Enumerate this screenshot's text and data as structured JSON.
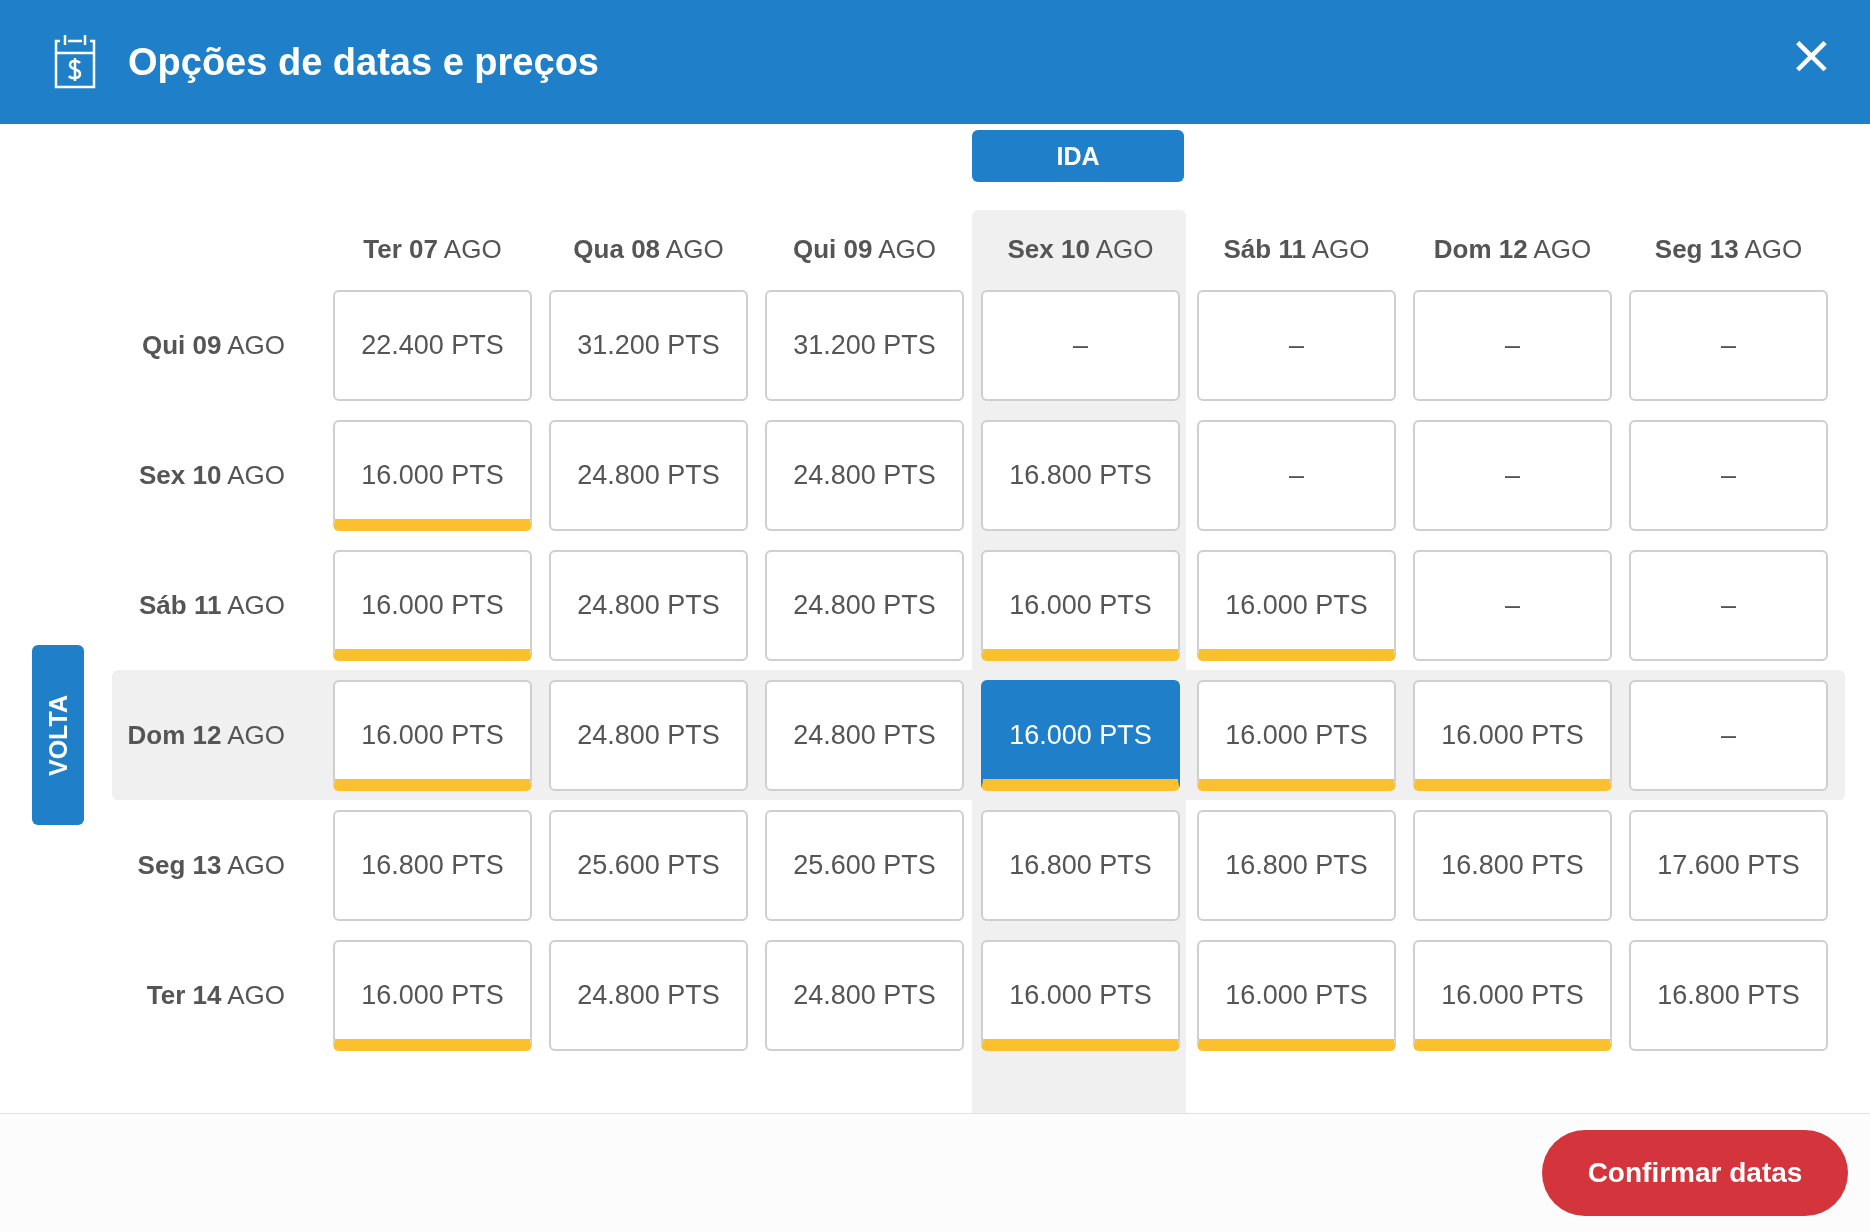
{
  "dialog": {
    "title": "Opções de datas e preços",
    "close": "×"
  },
  "outbound_tab": "IDA",
  "return_tab": "VOLTA",
  "columns": [
    {
      "label": "**Ter 07** AGO",
      "selected": false
    },
    {
      "label": "**Qua 08** AGO",
      "selected": false
    },
    {
      "label": "**Qui 09** AGO",
      "selected": false
    },
    {
      "label": "**Sex 10** AGO",
      "selected": true
    },
    {
      "label": "**Sáb 11** AGO",
      "selected": false
    },
    {
      "label": "**Dom 12** AGO",
      "selected": false
    },
    {
      "label": "**Seg 13** AGO",
      "selected": false
    }
  ],
  "rows": [
    {
      "label": "**Qui 09** AGO",
      "selected": false,
      "cells": [
        {
          "price": "22.400 PTS",
          "lowest": false,
          "selected": false
        },
        {
          "price": "31.200 PTS",
          "lowest": false,
          "selected": false
        },
        {
          "price": "31.200 PTS",
          "lowest": false,
          "selected": false
        },
        {
          "price": "–",
          "lowest": false,
          "selected": false
        },
        {
          "price": "–",
          "lowest": false,
          "selected": false
        },
        {
          "price": "–",
          "lowest": false,
          "selected": false
        },
        {
          "price": "–",
          "lowest": false,
          "selected": false
        }
      ]
    },
    {
      "label": "**Sex 10** AGO",
      "selected": false,
      "cells": [
        {
          "price": "16.000 PTS",
          "lowest": true,
          "selected": false
        },
        {
          "price": "24.800 PTS",
          "lowest": false,
          "selected": false
        },
        {
          "price": "24.800 PTS",
          "lowest": false,
          "selected": false
        },
        {
          "price": "16.800 PTS",
          "lowest": false,
          "selected": false
        },
        {
          "price": "–",
          "lowest": false,
          "selected": false
        },
        {
          "price": "–",
          "lowest": false,
          "selected": false
        },
        {
          "price": "–",
          "lowest": false,
          "selected": false
        }
      ]
    },
    {
      "label": "**Sáb 11** AGO",
      "selected": false,
      "cells": [
        {
          "price": "16.000 PTS",
          "lowest": true,
          "selected": false
        },
        {
          "price": "24.800 PTS",
          "lowest": false,
          "selected": false
        },
        {
          "price": "24.800 PTS",
          "lowest": false,
          "selected": false
        },
        {
          "price": "16.000 PTS",
          "lowest": true,
          "selected": false
        },
        {
          "price": "16.000 PTS",
          "lowest": true,
          "selected": false
        },
        {
          "price": "–",
          "lowest": false,
          "selected": false
        },
        {
          "price": "–",
          "lowest": false,
          "selected": false
        }
      ]
    },
    {
      "label": "**Dom 12** AGO",
      "selected": true,
      "cells": [
        {
          "price": "16.000 PTS",
          "lowest": true,
          "selected": false
        },
        {
          "price": "24.800 PTS",
          "lowest": false,
          "selected": false
        },
        {
          "price": "24.800 PTS",
          "lowest": false,
          "selected": false
        },
        {
          "price": "16.000 PTS",
          "lowest": true,
          "selected": true
        },
        {
          "price": "16.000 PTS",
          "lowest": true,
          "selected": false
        },
        {
          "price": "16.000 PTS",
          "lowest": true,
          "selected": false
        },
        {
          "price": "–",
          "lowest": false,
          "selected": false
        }
      ]
    },
    {
      "label": "**Seg 13** AGO",
      "selected": false,
      "cells": [
        {
          "price": "16.800 PTS",
          "lowest": false,
          "selected": false
        },
        {
          "price": "25.600 PTS",
          "lowest": false,
          "selected": false
        },
        {
          "price": "25.600 PTS",
          "lowest": false,
          "selected": false
        },
        {
          "price": "16.800 PTS",
          "lowest": false,
          "selected": false
        },
        {
          "price": "16.800 PTS",
          "lowest": false,
          "selected": false
        },
        {
          "price": "16.800 PTS",
          "lowest": false,
          "selected": false
        },
        {
          "price": "17.600 PTS",
          "lowest": false,
          "selected": false
        }
      ]
    },
    {
      "label": "**Ter 14** AGO",
      "selected": false,
      "cells": [
        {
          "price": "16.000 PTS",
          "lowest": true,
          "selected": false
        },
        {
          "price": "24.800 PTS",
          "lowest": false,
          "selected": false
        },
        {
          "price": "24.800 PTS",
          "lowest": false,
          "selected": false
        },
        {
          "price": "16.000 PTS",
          "lowest": true,
          "selected": false
        },
        {
          "price": "16.000 PTS",
          "lowest": true,
          "selected": false
        },
        {
          "price": "16.000 PTS",
          "lowest": true,
          "selected": false
        },
        {
          "price": "16.800 PTS",
          "lowest": false,
          "selected": false
        }
      ]
    }
  ],
  "confirm_button": "Confirmar datas"
}
